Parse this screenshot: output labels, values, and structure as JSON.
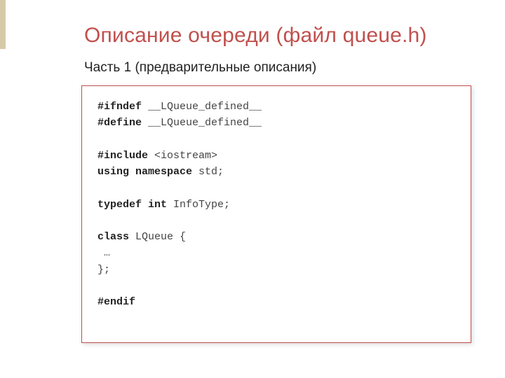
{
  "title": "Описание очереди  (файл queue.h)",
  "subtitle": "Часть 1 (предварительные описания)",
  "code": {
    "l1a": "#ifndef",
    "l1b": " __LQueue_defined__",
    "l2a": "#define",
    "l2b": " __LQueue_defined__",
    "l3": "",
    "l4a": "#include",
    "l4b": " <iostream>",
    "l5a": "using namespace",
    "l5b": " std;",
    "l6": "",
    "l7a": "typedef int",
    "l7b": " InfoType;",
    "l8": "",
    "l9a": "class",
    "l9b": " LQueue {",
    "l10": " …",
    "l11": "};",
    "l12": "",
    "l13a": "#endif"
  }
}
